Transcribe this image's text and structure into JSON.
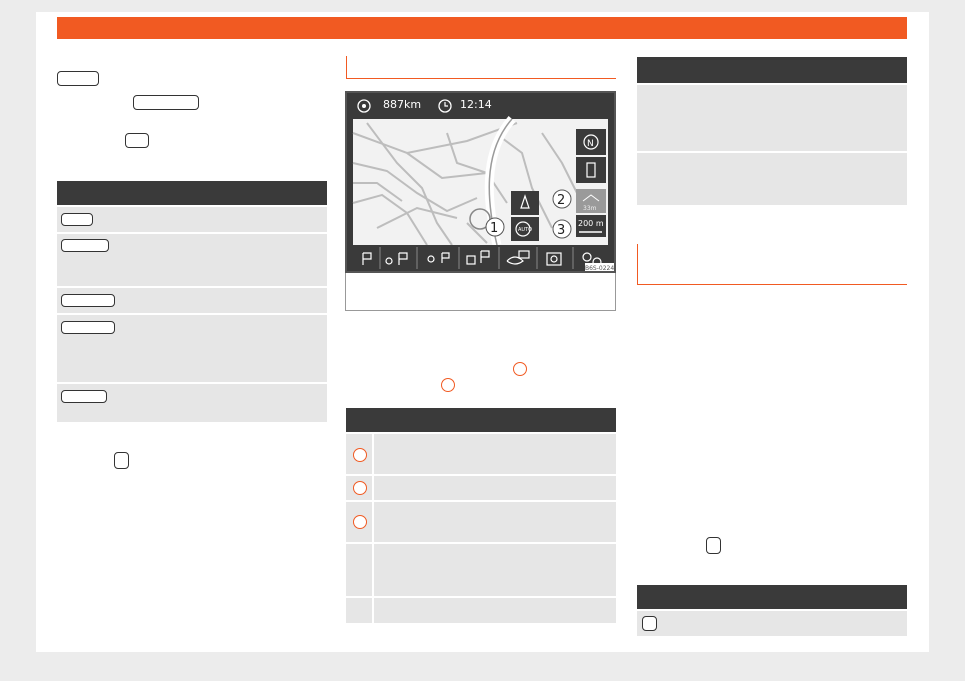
{
  "map": {
    "distance": "887km",
    "time": "12:14",
    "auto_label": "AUTO",
    "callouts": [
      "1",
      "2",
      "3"
    ],
    "scale": "200 m",
    "small_scale": "33m",
    "code": "B6S-0224"
  }
}
